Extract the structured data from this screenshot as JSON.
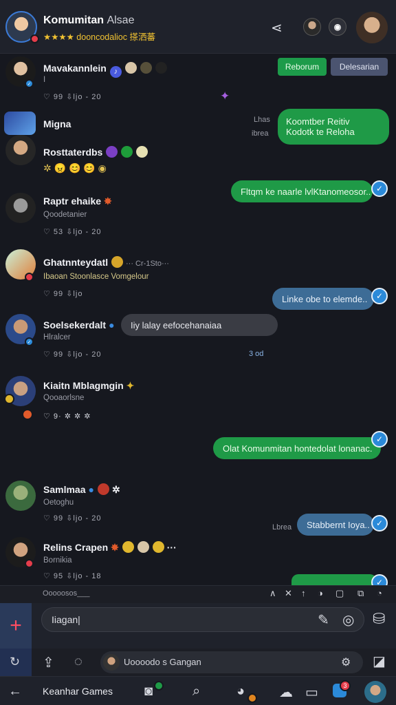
{
  "header": {
    "title": "Komumitan",
    "title_suffix": "Alsae",
    "subtitle": "★★★★ dooncodalioc 搽洒蕃",
    "share_icon": "share-icon"
  },
  "actions": {
    "primary_label": "Reborum",
    "secondary_label": "Delesarian"
  },
  "messages": [
    {
      "name": "Mavakannlein",
      "sub": "I",
      "stats": "♡ 99   ⇩ljo  -  20"
    },
    {
      "name": "Migna"
    },
    {
      "name": "Rosttaterdbs",
      "sub": "✲ 😠  😊 😊 ◉"
    },
    {
      "name": "Raptr ehaike",
      "sub": "Qoodetanier",
      "stats": "♡ 53   ⇩ljo  -  20"
    },
    {
      "name": "Ghatnnteydatl",
      "name_extra": "··· Cr-1Sto···",
      "sub": "Ibaoan Stoonlasce Vomgelour",
      "stats": "♡ 99   ⇩ljo"
    },
    {
      "name": "Soelsekerdalt",
      "sub": "Hlralcer",
      "stats": "♡ 99   ⇩ljo  -  20"
    },
    {
      "name": "Kiaitn Mblagmgin",
      "sub": "Qooaorlsne",
      "stats": "♡ 9·  ✲  ✲  ✲"
    },
    {
      "name": "Samlmaa",
      "sub": "Oetoghu",
      "stats": "♡ 99   ⇩ljo  -  20"
    },
    {
      "name": "Relins Crapen",
      "sub": "Bornikia",
      "stats": "♡ 95   ⇩ljo  -  18"
    }
  ],
  "bubbles": {
    "b1": "Koomtber Reitiv",
    "b1_line2": "Kodotk te Reloha",
    "b1_side1": "Lhas",
    "b1_side2": "ibrea",
    "b2": "Fltqm ke naarle lvlKtanomeosor..",
    "b3": "Linke obe to elemde..",
    "b4": "Iiy lalay eefocehanaiaa",
    "b4_side": "3 od",
    "b5": "Olat Komunmitan hontedolat lonanac.",
    "b6": "Stabbernt Ioya..",
    "b6_side": "Lbrea"
  },
  "composer": {
    "status_text": "Ooooosos___",
    "input_value": "Iiagan|",
    "linked_user": "Uoooodo s Gangan"
  },
  "nav": {
    "title": "Keanhar Games",
    "badge_count": "3"
  }
}
